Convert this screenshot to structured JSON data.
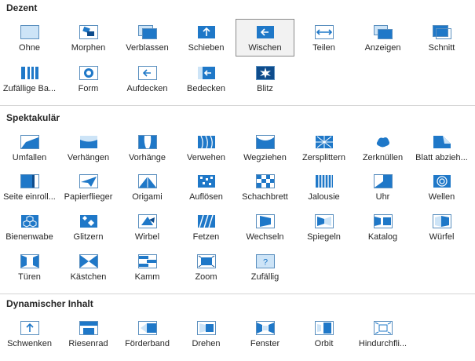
{
  "colors": {
    "accent": "#1f78c8",
    "light": "#cde4f7",
    "dark": "#0e4c8c",
    "frame": "#5a8fbf"
  },
  "sections": [
    {
      "title": "Dezent",
      "rows": [
        [
          {
            "label": "Ohne",
            "icon": "ohne-icon"
          },
          {
            "label": "Morphen",
            "icon": "morphen-icon"
          },
          {
            "label": "Verblassen",
            "icon": "verblassen-icon"
          },
          {
            "label": "Schieben",
            "icon": "schieben-icon"
          },
          {
            "label": "Wischen",
            "icon": "wischen-icon",
            "selected": true
          },
          {
            "label": "Teilen",
            "icon": "teilen-icon"
          },
          {
            "label": "Anzeigen",
            "icon": "anzeigen-icon"
          },
          {
            "label": "Schnitt",
            "icon": "schnitt-icon"
          }
        ],
        [
          {
            "label": "Zufällige Ba...",
            "icon": "zufaellige-balken-icon"
          },
          {
            "label": "Form",
            "icon": "form-icon"
          },
          {
            "label": "Aufdecken",
            "icon": "aufdecken-icon"
          },
          {
            "label": "Bedecken",
            "icon": "bedecken-icon"
          },
          {
            "label": "Blitz",
            "icon": "blitz-icon"
          }
        ]
      ]
    },
    {
      "title": "Spektakulär",
      "rows": [
        [
          {
            "label": "Umfallen",
            "icon": "umfallen-icon"
          },
          {
            "label": "Verhängen",
            "icon": "verhaengen-icon"
          },
          {
            "label": "Vorhänge",
            "icon": "vorhaenge-icon"
          },
          {
            "label": "Verwehen",
            "icon": "verwehen-icon"
          },
          {
            "label": "Wegziehen",
            "icon": "wegziehen-icon"
          },
          {
            "label": "Zersplittern",
            "icon": "zersplittern-icon"
          },
          {
            "label": "Zerknüllen",
            "icon": "zerknuellen-icon"
          },
          {
            "label": "Blatt abzieh...",
            "icon": "blatt-abziehen-icon"
          }
        ],
        [
          {
            "label": "Seite einroll...",
            "icon": "seite-einrollen-icon"
          },
          {
            "label": "Papierflieger",
            "icon": "papierflieger-icon"
          },
          {
            "label": "Origami",
            "icon": "origami-icon"
          },
          {
            "label": "Auflösen",
            "icon": "aufloesen-icon"
          },
          {
            "label": "Schachbrett",
            "icon": "schachbrett-icon"
          },
          {
            "label": "Jalousie",
            "icon": "jalousie-icon"
          },
          {
            "label": "Uhr",
            "icon": "uhr-icon"
          },
          {
            "label": "Wellen",
            "icon": "wellen-icon"
          }
        ],
        [
          {
            "label": "Bienenwabe",
            "icon": "bienenwabe-icon"
          },
          {
            "label": "Glitzern",
            "icon": "glitzern-icon"
          },
          {
            "label": "Wirbel",
            "icon": "wirbel-icon"
          },
          {
            "label": "Fetzen",
            "icon": "fetzen-icon"
          },
          {
            "label": "Wechseln",
            "icon": "wechseln-icon"
          },
          {
            "label": "Spiegeln",
            "icon": "spiegeln-icon"
          },
          {
            "label": "Katalog",
            "icon": "katalog-icon"
          },
          {
            "label": "Würfel",
            "icon": "wuerfel-icon"
          }
        ],
        [
          {
            "label": "Türen",
            "icon": "tueren-icon"
          },
          {
            "label": "Kästchen",
            "icon": "kaestchen-icon"
          },
          {
            "label": "Kamm",
            "icon": "kamm-icon"
          },
          {
            "label": "Zoom",
            "icon": "zoom-icon"
          },
          {
            "label": "Zufällig",
            "icon": "zufaellig-icon"
          }
        ]
      ]
    },
    {
      "title": "Dynamischer Inhalt",
      "rows": [
        [
          {
            "label": "Schwenken",
            "icon": "schwenken-icon"
          },
          {
            "label": "Riesenrad",
            "icon": "riesenrad-icon"
          },
          {
            "label": "Förderband",
            "icon": "foerderband-icon"
          },
          {
            "label": "Drehen",
            "icon": "drehen-icon"
          },
          {
            "label": "Fenster",
            "icon": "fenster-icon"
          },
          {
            "label": "Orbit",
            "icon": "orbit-icon"
          },
          {
            "label": "Hindurchfli...",
            "icon": "hindurchfliegen-icon"
          }
        ]
      ]
    }
  ]
}
